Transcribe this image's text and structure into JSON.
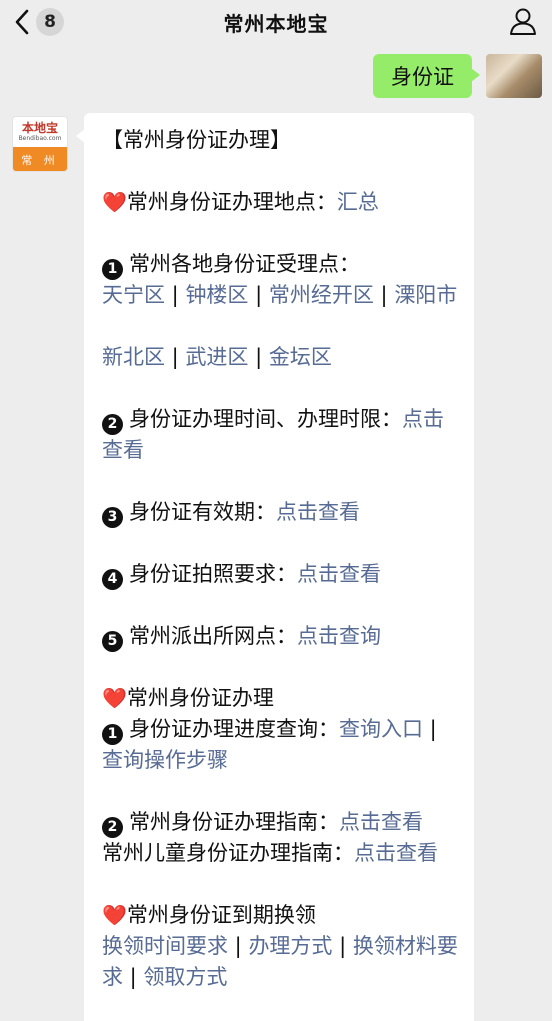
{
  "header": {
    "title": "常州本地宝",
    "unread_count": "8"
  },
  "user_message": {
    "text": "身份证"
  },
  "bot": {
    "avatar": {
      "name": "本地宝",
      "url": "Bendibao.com",
      "city": "常 州"
    },
    "heading": "【常州身份证办理】",
    "s1": {
      "label": "常州身份证办理地点：",
      "link": "汇总"
    },
    "s2": {
      "label": "常州各地身份证受理点：",
      "num": "1",
      "links1": [
        "天宁区",
        "钟楼区",
        "常州经开区",
        "溧阳市"
      ],
      "links2": [
        "新北区",
        "武进区",
        "金坛区"
      ]
    },
    "s3": {
      "num": "2",
      "label": "身份证办理时间、办理时限：",
      "link": "点击查看"
    },
    "s4": {
      "num": "3",
      "label": "身份证有效期：",
      "link": "点击查看"
    },
    "s5": {
      "num": "4",
      "label": "身份证拍照要求：",
      "link": "点击查看"
    },
    "s6": {
      "num": "5",
      "label": "常州派出所网点：",
      "link": "点击查询"
    },
    "s7": {
      "label": "常州身份证办理",
      "num": "1",
      "item_label": "身份证办理进度查询：",
      "link1": "查询入口",
      "link2": "查询操作步骤"
    },
    "s8": {
      "num": "2",
      "label": "常州身份证办理指南：",
      "link": "点击查看",
      "label2": "常州儿童身份证办理指南：",
      "link2": "点击查看"
    },
    "s9": {
      "label": "常州身份证到期换领",
      "links": [
        "换领时间要求",
        "办理方式",
        "换领材料要求",
        "领取方式"
      ]
    }
  },
  "icons": {
    "back": "back-chevron-icon",
    "profile": "person-icon",
    "heart": "heart-icon"
  },
  "colors": {
    "link": "#576b95",
    "bubble_green": "#95ec69",
    "background": "#ededed"
  }
}
